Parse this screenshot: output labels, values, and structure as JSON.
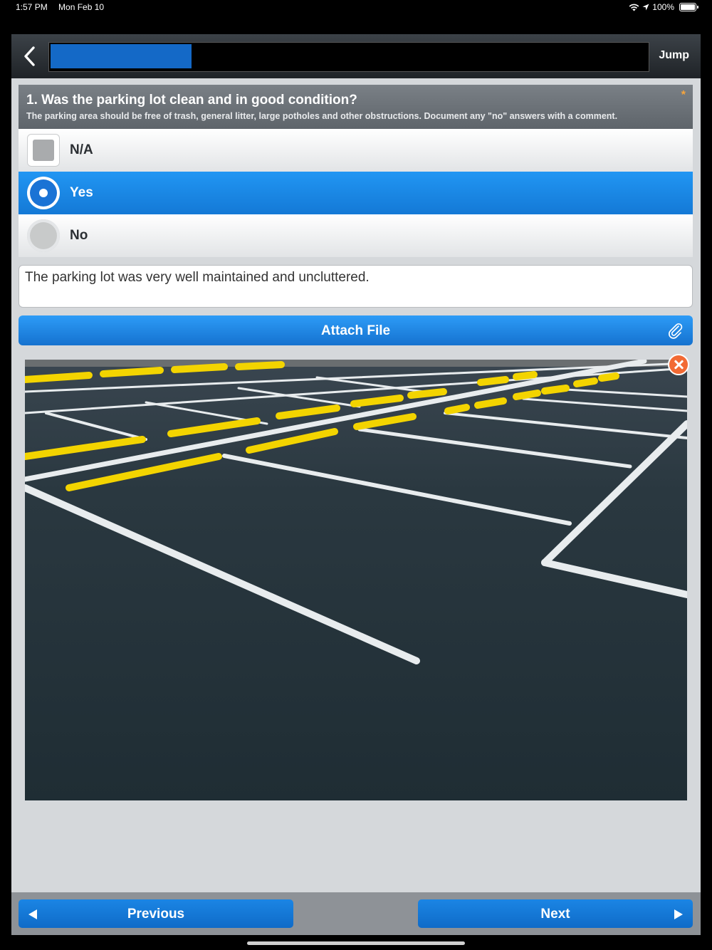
{
  "status_bar": {
    "time": "1:57 PM",
    "date": "Mon Feb 10",
    "battery": "100%",
    "icons": [
      "wifi-icon",
      "location-arrow-icon",
      "battery-icon"
    ]
  },
  "header": {
    "jump_label": "Jump",
    "back_icon": "chevron-left-icon"
  },
  "question": {
    "title": "1. Was the parking lot clean and in good condition?",
    "description": "The parking area should be free of trash, general litter, large potholes and other obstructions. Document any \"no\" answers with a comment.",
    "required_marker": "*"
  },
  "options": [
    {
      "label": "N/A",
      "type": "checkbox",
      "selected": false
    },
    {
      "label": "Yes",
      "type": "radio",
      "selected": true
    },
    {
      "label": "No",
      "type": "radio",
      "selected": false
    }
  ],
  "comment": {
    "value": "The parking lot was very well maintained and uncluttered."
  },
  "attach": {
    "label": "Attach File",
    "icon": "paperclip-icon"
  },
  "attachment": {
    "description": "photo-of-parking-lot",
    "remove_icon": "close-icon"
  },
  "navigation": {
    "previous_label": "Previous",
    "next_label": "Next"
  },
  "colors": {
    "accent": "#1479d6",
    "selected_row": "#2196f3",
    "required": "#f7a53c",
    "remove": "#f26a34"
  }
}
